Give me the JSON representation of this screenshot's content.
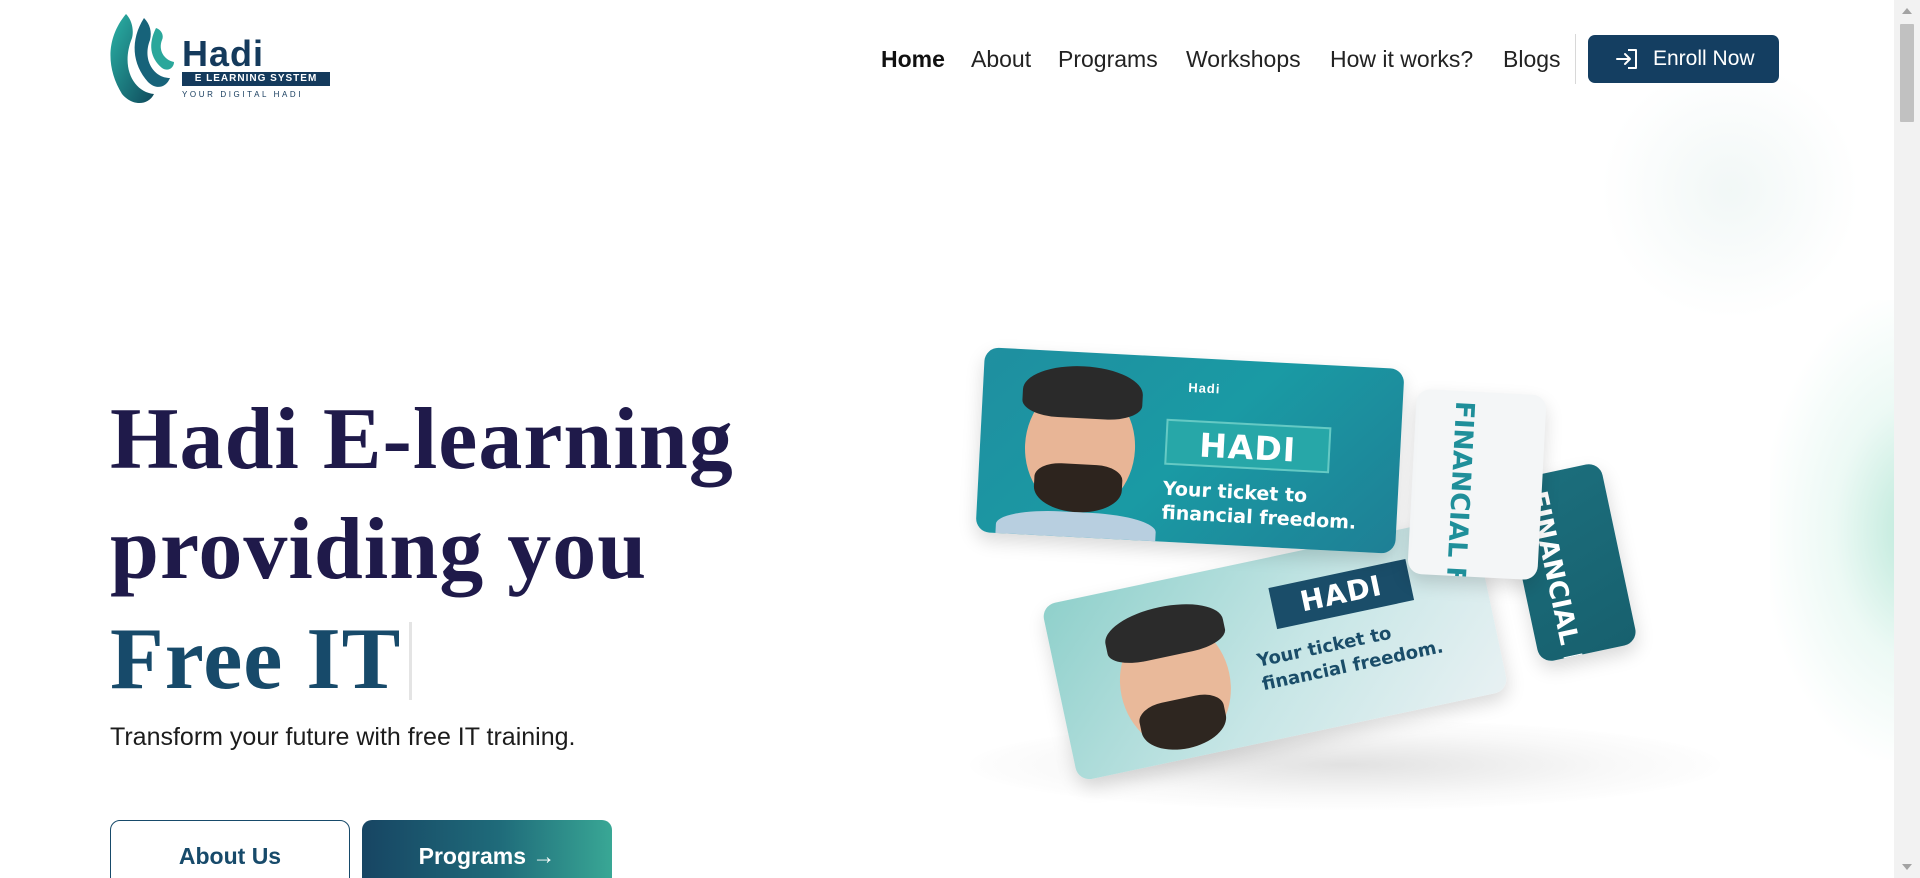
{
  "brand": {
    "name": "Hadi",
    "band_text": "E LEARNING SYSTEM",
    "tagline": "YOUR DIGITAL HADI",
    "primary_color": "#143e61",
    "accent_color": "#39a795",
    "icon": "hadi-flame-logo-icon"
  },
  "nav": {
    "items": [
      {
        "label": "Home",
        "active": true
      },
      {
        "label": "About",
        "active": false
      },
      {
        "label": "Programs",
        "active": false
      },
      {
        "label": "Workshops",
        "active": false
      },
      {
        "label": "How it works?",
        "active": false
      },
      {
        "label": "Blogs",
        "active": false
      }
    ],
    "cta_label": "Enroll Now",
    "cta_icon": "login-arrow-icon"
  },
  "hero": {
    "headline_line1": "Hadi E-learning",
    "headline_line2": "providing you",
    "headline_line3": "Free IT",
    "subtitle": "Transform your future with free IT training.",
    "about_button": "About Us",
    "programs_button": "Programs →"
  },
  "illustration": {
    "ticket_label": "HADI",
    "ticket_caption_line1": "Your ticket to",
    "ticket_caption_line2": "financial freedom.",
    "stub_text_line1": "FINANCIAL",
    "stub_text_line2": "FREEDOM.",
    "mini_logo": "Hadi"
  }
}
